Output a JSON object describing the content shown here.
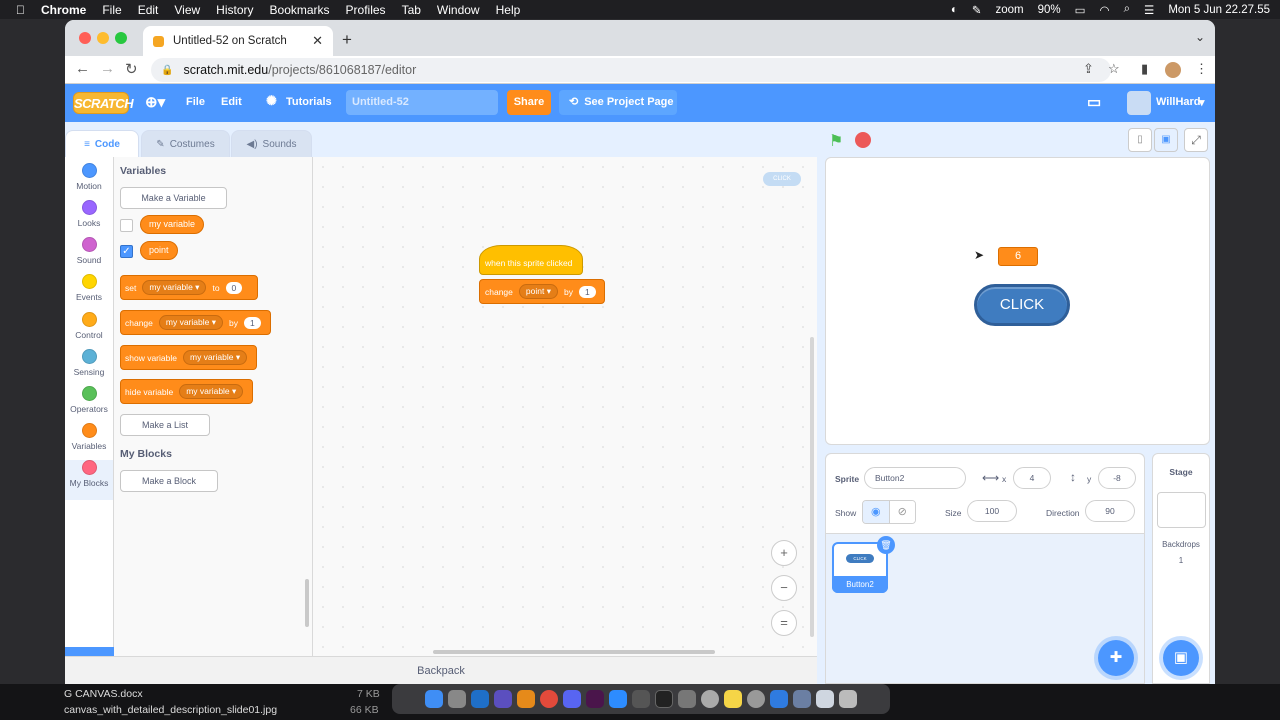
{
  "macmenu": {
    "apple": "",
    "app": "Chrome",
    "items": [
      "File",
      "Edit",
      "View",
      "History",
      "Bookmarks",
      "Profiles",
      "Tab",
      "Window",
      "Help"
    ],
    "zoom": "zoom",
    "battery": "90%",
    "datetime": "Mon 5 Jun  22.27.55"
  },
  "browser": {
    "tab_title": "Untitled-52 on Scratch",
    "url_host": "scratch.mit.edu",
    "url_path": "/projects/861068187/editor"
  },
  "scratch_menu": {
    "logo": "SCRATCH",
    "file": "File",
    "edit": "Edit",
    "tutorials": "Tutorials",
    "project_title": "Untitled-52",
    "share": "Share",
    "see_project": "See Project Page",
    "user": "WillHard"
  },
  "editor_tabs": {
    "code": "Code",
    "costumes": "Costumes",
    "sounds": "Sounds"
  },
  "categories": [
    {
      "label": "Motion",
      "color": "#4c97ff"
    },
    {
      "label": "Looks",
      "color": "#9966ff"
    },
    {
      "label": "Sound",
      "color": "#cf63cf"
    },
    {
      "label": "Events",
      "color": "#ffd500"
    },
    {
      "label": "Control",
      "color": "#ffab19"
    },
    {
      "label": "Sensing",
      "color": "#5cb1d6"
    },
    {
      "label": "Operators",
      "color": "#59c059"
    },
    {
      "label": "Variables",
      "color": "#ff8c1a"
    },
    {
      "label": "My Blocks",
      "color": "#ff6680"
    }
  ],
  "palette": {
    "variables_heading": "Variables",
    "make_variable": "Make a Variable",
    "var1": "my variable",
    "var2": "point",
    "set_block": {
      "op": "set",
      "var": "my variable",
      "to": "to",
      "value": "0"
    },
    "change_block": {
      "op": "change",
      "var": "my variable",
      "by": "by",
      "value": "1"
    },
    "show_block": {
      "op": "show variable",
      "var": "my variable"
    },
    "hide_block": {
      "op": "hide variable",
      "var": "my variable"
    },
    "make_list": "Make a List",
    "myblocks_heading": "My Blocks",
    "make_block": "Make a Block"
  },
  "script": {
    "hat": "when this sprite clicked",
    "op": "change",
    "var": "point",
    "by": "by",
    "value": "1"
  },
  "workspace": {
    "sprite_thumb": "CLICK",
    "zoom_in": "+",
    "zoom_out": "−",
    "zoom_reset": "="
  },
  "backpack": "Backpack",
  "stage": {
    "monitor_value": "6",
    "button_label": "CLICK"
  },
  "sprite_info": {
    "sprite_label": "Sprite",
    "sprite_name": "Button2",
    "x_label": "x",
    "x": "4",
    "y_label": "y",
    "y": "-8",
    "show_label": "Show",
    "size_label": "Size",
    "size": "100",
    "direction_label": "Direction",
    "direction": "90"
  },
  "sprite_list": [
    {
      "name": "Button2",
      "thumb": "CLICK"
    }
  ],
  "stage_panel": {
    "label": "Stage",
    "backdrops_label": "Backdrops",
    "backdrops_count": "1"
  },
  "finder": {
    "file1": "G CANVAS.docx",
    "file1_size": "7 KB",
    "file2": "canvas_with_detailed_description_slide01.jpg",
    "file2_size": "66 KB"
  }
}
